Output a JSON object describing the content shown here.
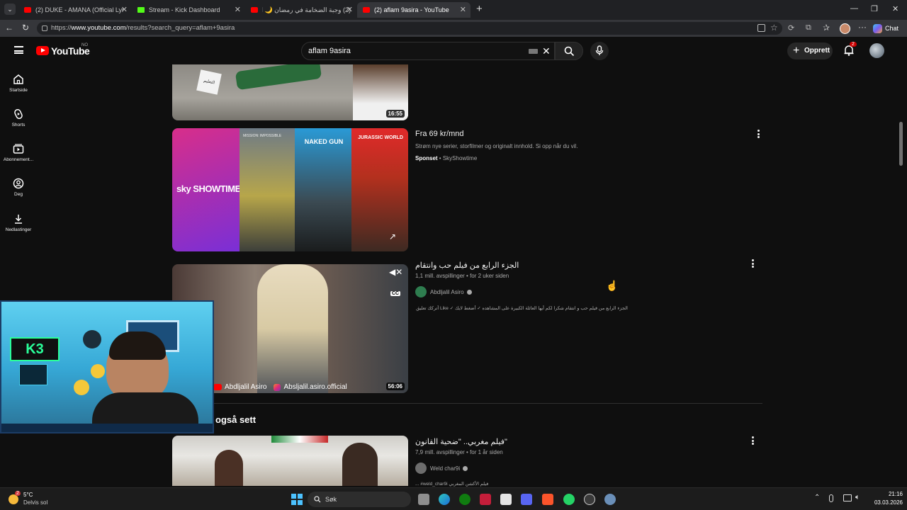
{
  "browser": {
    "tabs": [
      {
        "label": "(2) DUKE - AMANA (Official Lyric V",
        "icon": "youtube-icon",
        "active": false
      },
      {
        "label": "Stream - Kick Dashboard",
        "icon": "kick-icon",
        "active": false
      },
      {
        "label": "(2) وجبة الضخامة في رمضان 🌙 الـ",
        "icon": "youtube-icon",
        "active": false
      },
      {
        "label": "(2) aflam 9asira - YouTube",
        "icon": "youtube-icon",
        "active": true
      }
    ],
    "url_prefix": "https://",
    "url_host": "www.youtube.com",
    "url_path": "/results?search_query=aflam+9asira",
    "copilot_label": "Chat"
  },
  "youtube": {
    "logo_text": "YouTube",
    "country_code": "NO",
    "search_value": "aflam 9asira",
    "create_label": "Opprett",
    "notification_count": "2",
    "sidebar": [
      {
        "label": "Startside",
        "icon": "home-icon"
      },
      {
        "label": "Shorts",
        "icon": "shorts-icon"
      },
      {
        "label": "Abonnement...",
        "icon": "subscriptions-icon"
      },
      {
        "label": "Deg",
        "icon": "you-icon"
      },
      {
        "label": "Nedlastinger",
        "icon": "download-icon"
      }
    ],
    "results": [
      {
        "duration": "16:55",
        "overlay_text": "التعليم"
      },
      {
        "title": "Fra 69 kr/mnd",
        "description": "Strøm nye serier, storfilmer og originalt innhold. Si opp når du vil.",
        "sponsored_label": "Sponset",
        "advertiser": "SkyShowtime",
        "brand_text": "sky SHOWTIME",
        "poster_texts": [
          "MISSION: IMPOSSIBLE",
          "NAKED GUN",
          "JURASSIC WORLD"
        ]
      },
      {
        "title": "الجزء الرابع من فيلم حب وانتقام",
        "views": "1,1 mill. avspillinger",
        "age": "for 2 uker siden",
        "channel": "Abdljalil Asiro",
        "snippet": "الجزء الرابع من فيلم حب و انتقام شكرا لكم أيها العائلة الكبيرة على المشاهده ✓ أضغط لايك ✓ Like أتركك تعليق ✓ ...",
        "duration": "56:06",
        "cc_label": "CC",
        "watermark_1": "Abdljalil Asiro",
        "watermark_2": "Absljalil.asiro.official"
      }
    ],
    "section_title": "Andre har også sett",
    "section_title_visible": "også sett",
    "more_results": [
      {
        "title": "فيلم مغربي.. \"ضحية القانون\"",
        "views": "7,9 mill. avspillinger",
        "age": "for 1 år siden",
        "channel": "Weld char9i",
        "snippet": "... #weld_char9i فيلم الأكشن المغربي"
      }
    ]
  },
  "webcam": {
    "sign_text": "K3"
  },
  "taskbar": {
    "weather_temp": "5°C",
    "weather_desc": "Delvis sol",
    "weather_badge": "2",
    "search_label": "Søk",
    "time": "21:16",
    "date": "03.03.2026"
  }
}
